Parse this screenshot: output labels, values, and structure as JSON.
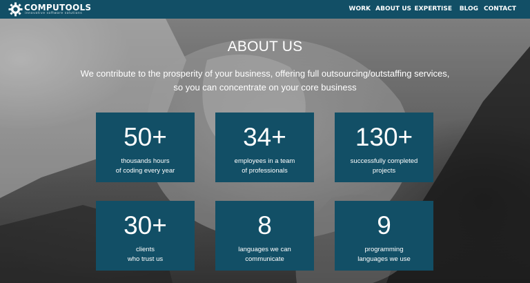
{
  "brand": {
    "name": "COMPUTOOLS",
    "tagline": "innovative software solutions",
    "logo_icon": "gear-icon"
  },
  "nav": [
    {
      "label": "WORK"
    },
    {
      "label": "ABOUT US"
    },
    {
      "label": "EXPERTISE"
    },
    {
      "label": "BLOG"
    },
    {
      "label": "CONTACT"
    }
  ],
  "hero": {
    "title": "ABOUT US",
    "subtitle_line1": "We contribute to the prosperity of your business, offering full outsourcing/outstaffing services,",
    "subtitle_line2": "so you can concentrate on your core business"
  },
  "stats": [
    {
      "value": "50+",
      "label_line1": "thousands hours",
      "label_line2": "of coding every year"
    },
    {
      "value": "34+",
      "label_line1": "employees in a team",
      "label_line2": "of professionals"
    },
    {
      "value": "130+",
      "label_line1": "successfully completed",
      "label_line2": "projects"
    },
    {
      "value": "30+",
      "label_line1": "clients",
      "label_line2": "who trust us"
    },
    {
      "value": "8",
      "label_line1": "languages we can",
      "label_line2": "communicate"
    },
    {
      "value": "9",
      "label_line1": "programming",
      "label_line2": "languages we use"
    }
  ],
  "colors": {
    "brand_teal": "#124f66",
    "text": "#ffffff"
  }
}
